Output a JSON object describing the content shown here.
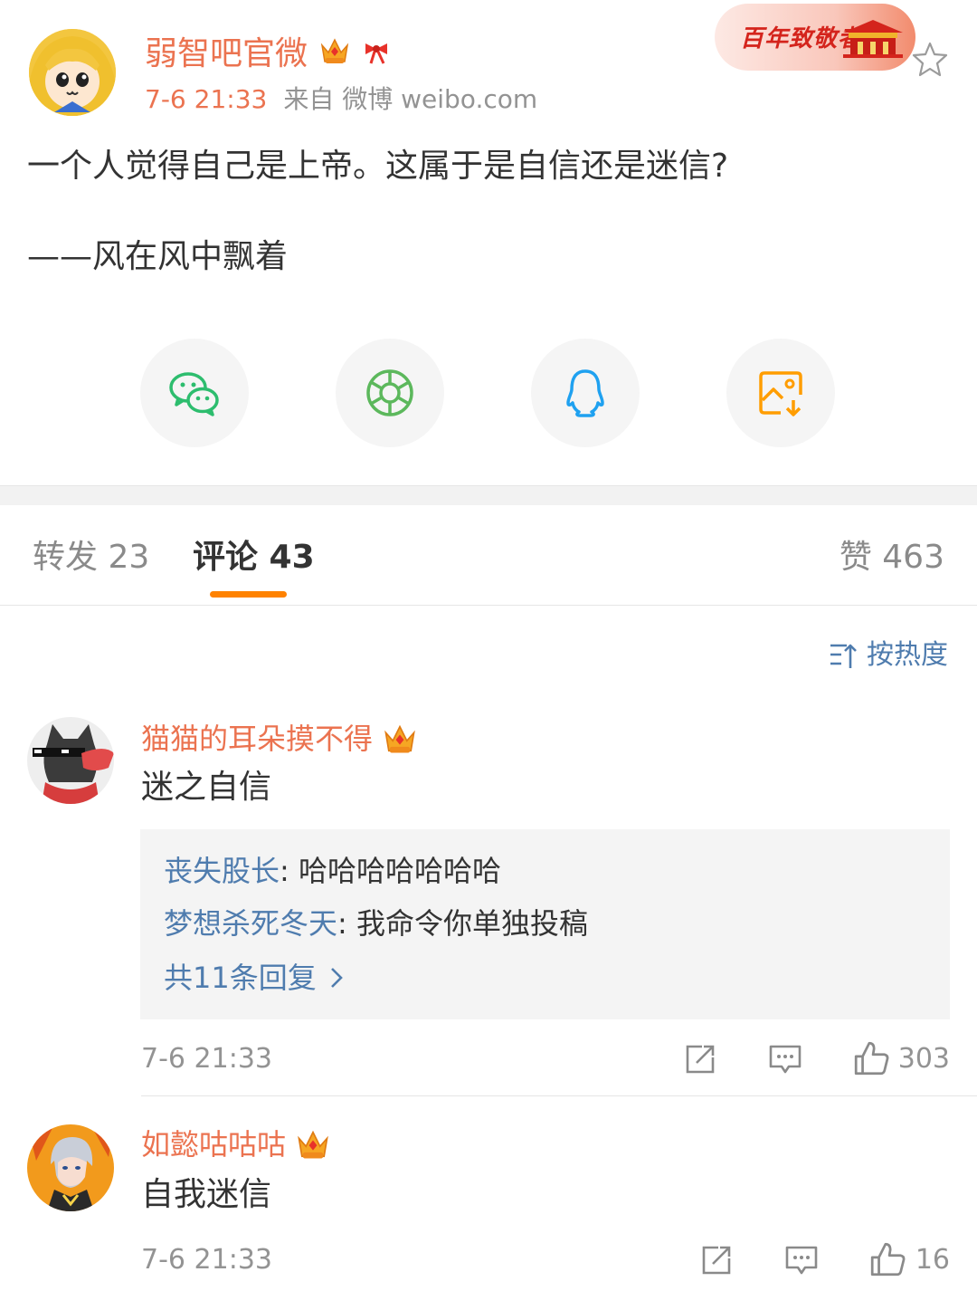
{
  "post": {
    "author": "弱智吧官微",
    "time": "7-6 21:33",
    "source": "来自 微博 weibo.com",
    "promo_badge": "百年致敬者",
    "text": "一个人觉得自己是上帝。这属于是自信还是迷信?",
    "credit": "——风在风中飘着"
  },
  "share": {
    "icons": [
      "wechat-icon",
      "moments-icon",
      "qq-icon",
      "save-image-icon"
    ],
    "colors": {
      "wechat": "#2dbd6e",
      "moments": "#5cb85c",
      "qq": "#1fa1f0",
      "save": "#ff9d00"
    }
  },
  "tabs": {
    "repost": "转发 23",
    "comment": "评论 43",
    "like": "赞 463"
  },
  "sort_label": "按热度",
  "comments": [
    {
      "user": "猫猫的耳朵摸不得",
      "text": "迷之自信",
      "replies": [
        {
          "user": "丧失股长",
          "sep": ": ",
          "text": "哈哈哈哈哈哈哈"
        },
        {
          "user": "梦想杀死冬天",
          "sep": ": ",
          "text": "我命令你单独投稿"
        }
      ],
      "more_replies": "共11条回复",
      "time": "7-6 21:33",
      "likes": "303"
    },
    {
      "user": "如懿咕咕咕",
      "text": "自我迷信",
      "time": "7-6 21:33",
      "likes": "16"
    }
  ],
  "colors": {
    "accent_orange": "#eb7350",
    "link_blue": "#4f7cae",
    "tab_indicator": "#ff8200",
    "muted": "#939393"
  }
}
